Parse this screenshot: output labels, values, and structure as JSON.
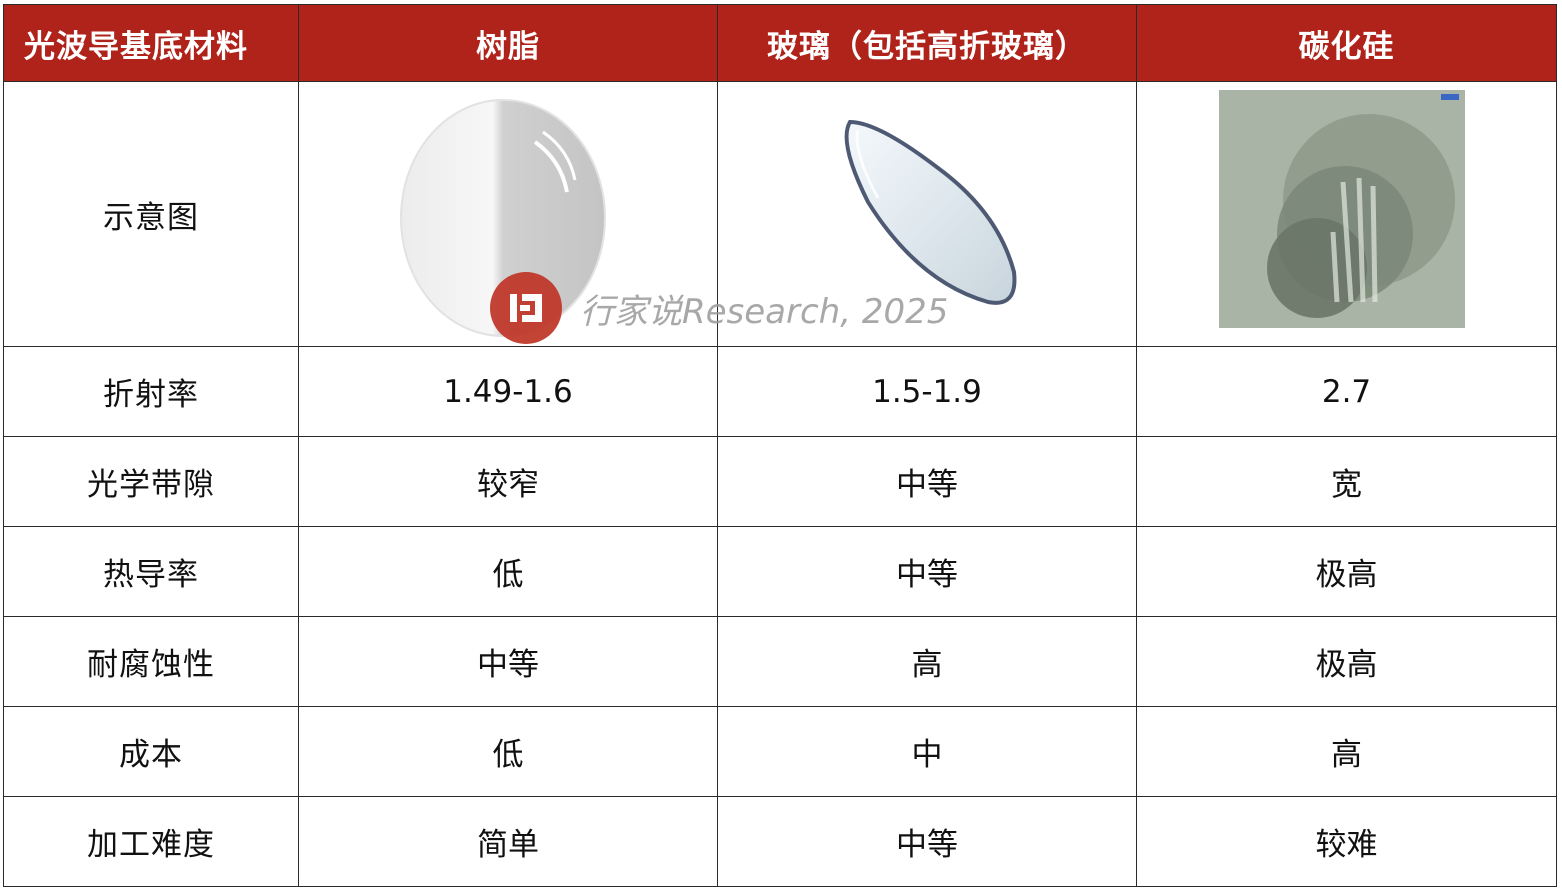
{
  "header": {
    "col0": "光波导基底材料",
    "col1": "树脂",
    "col2": "玻璃（包括高折玻璃）",
    "col3": "碳化硅"
  },
  "image_row_label": "示意图",
  "rows": [
    {
      "label": "折射率",
      "resin": "1.49-1.6",
      "glass": "1.5-1.9",
      "sic": "2.7"
    },
    {
      "label": "光学带隙",
      "resin": "较窄",
      "glass": "中等",
      "sic": "宽"
    },
    {
      "label": "热导率",
      "resin": "低",
      "glass": "中等",
      "sic": "极高"
    },
    {
      "label": "耐腐蚀性",
      "resin": "中等",
      "glass": "高",
      "sic": "极高"
    },
    {
      "label": "成本",
      "resin": "低",
      "glass": "中",
      "sic": "高"
    },
    {
      "label": "加工难度",
      "resin": "简单",
      "glass": "中等",
      "sic": "较难"
    }
  ],
  "watermark": "行家说Research, 2025",
  "colors": {
    "header_bg": "#b0231b",
    "header_text": "#ffffff",
    "border": "#2a2a2a",
    "sic_bg": "#a9b4a6"
  }
}
